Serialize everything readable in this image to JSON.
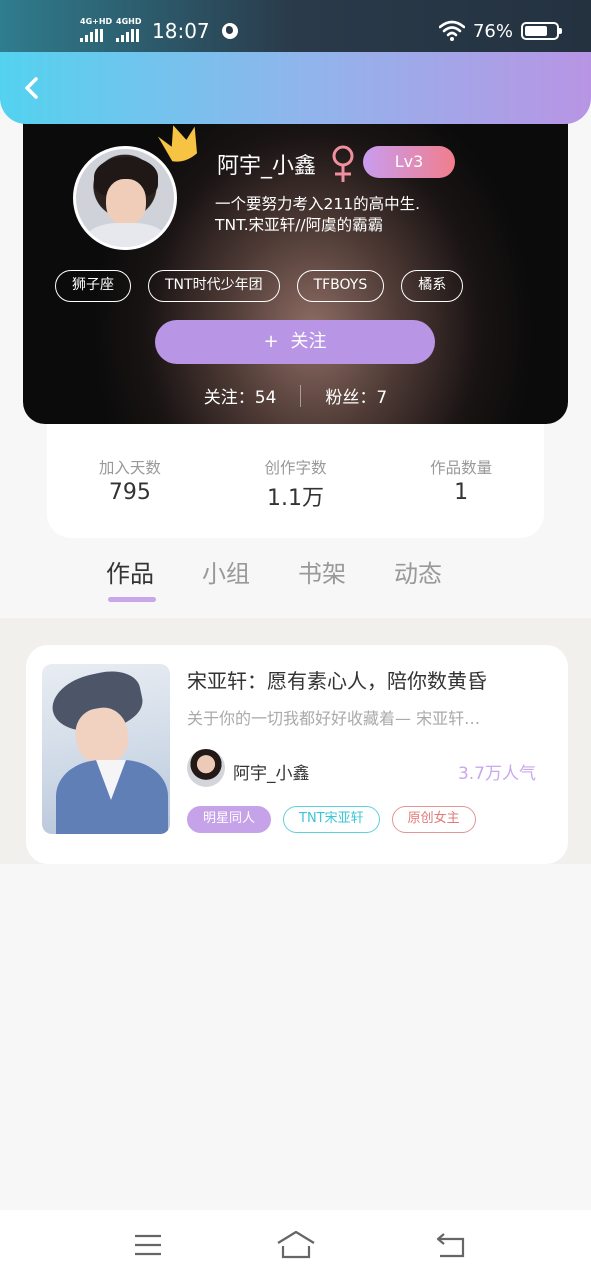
{
  "status_bar": {
    "network_1": "4G+HD",
    "network_2": "4GHD",
    "time": "18:07",
    "battery": "76%"
  },
  "header": {
    "back_icon": "chevron-left-icon"
  },
  "profile": {
    "username": "阿宇_小鑫",
    "level": "Lv3",
    "bio_line1": "一个要努力考入211的高中生.",
    "bio_line2": "TNT.宋亚轩//阿虞的霸霸",
    "tags": [
      "狮子座",
      "TNT时代少年团",
      "TFBOYS",
      "橘系"
    ],
    "follow_button": "关注",
    "following_label": "关注：54",
    "followers_label": "粉丝：7"
  },
  "stats": [
    {
      "label": "加入天数",
      "value": "795"
    },
    {
      "label": "创作字数",
      "value": "1.1万"
    },
    {
      "label": "作品数量",
      "value": "1"
    }
  ],
  "tabs": [
    {
      "label": "作品",
      "active": true
    },
    {
      "label": "小组",
      "active": false
    },
    {
      "label": "书架",
      "active": false
    },
    {
      "label": "动态",
      "active": false
    }
  ],
  "works": [
    {
      "title": "宋亚轩：愿有素心人，陪你数黄昏",
      "description": "关于你的一切我都好好收藏着— 宋亚轩…",
      "author": "阿宇_小鑫",
      "popularity": "3.7万人气",
      "tags": [
        "明星同人",
        "TNT宋亚轩",
        "原创女主"
      ]
    }
  ],
  "colors": {
    "header_gradient_start": "#53d2ef",
    "header_gradient_end": "#b895e4",
    "accent_purple": "#b995e6",
    "tag_cyan": "#3cc5d6",
    "tag_red": "#e27a78"
  },
  "nav": {
    "menu_icon": "menu-icon",
    "home_icon": "home-icon",
    "back_icon": "back-icon"
  }
}
